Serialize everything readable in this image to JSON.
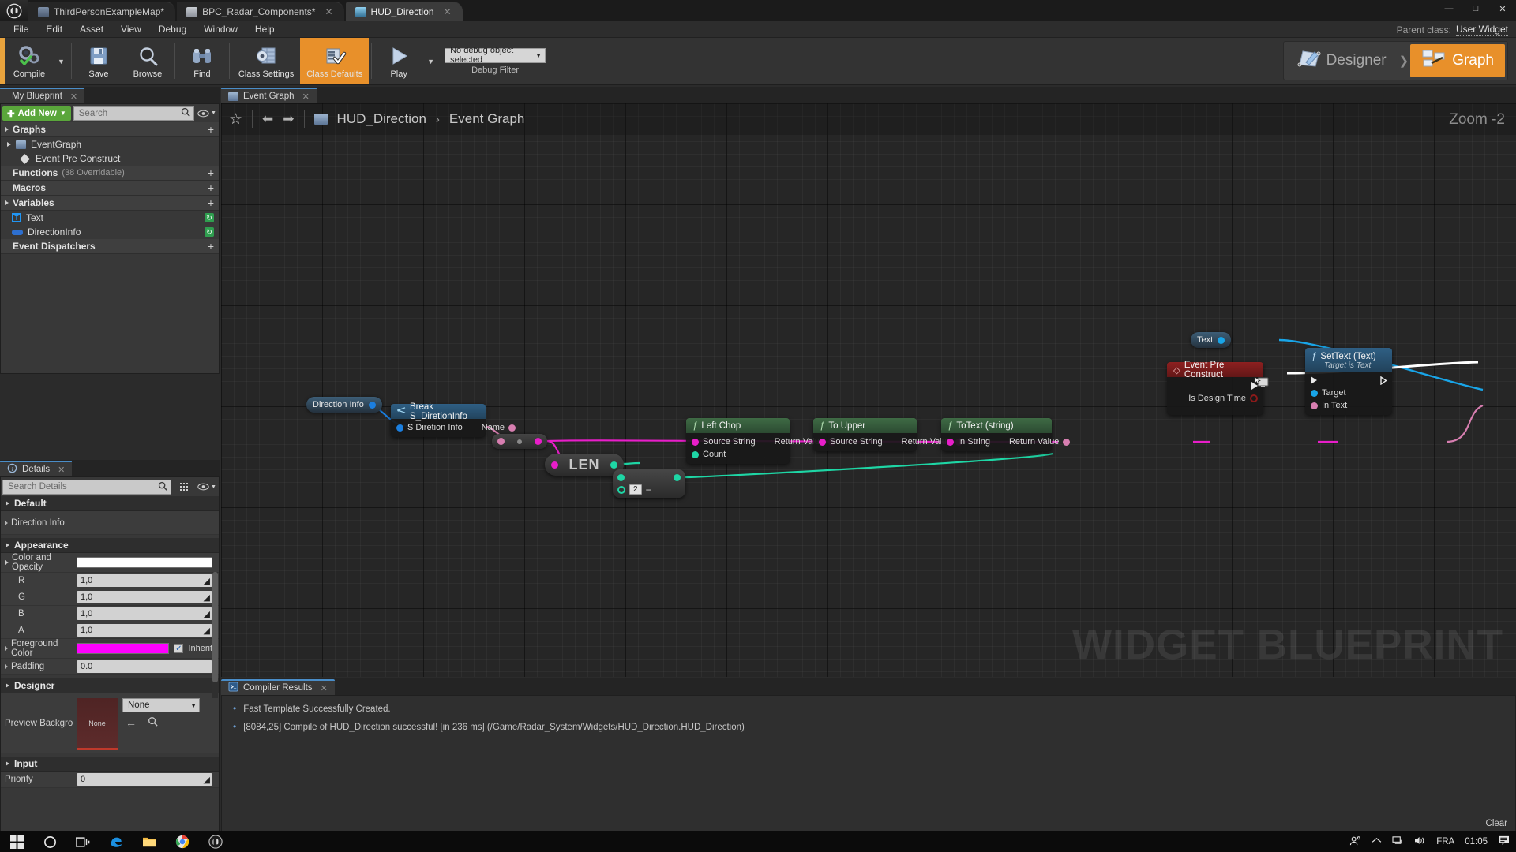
{
  "window": {
    "logo": "ue-logo",
    "tabs": [
      {
        "label": "ThirdPersonExampleMap*",
        "icon": "map-icon",
        "active": false,
        "closable": false
      },
      {
        "label": "BPC_Radar_Components*",
        "icon": "blueprint-icon",
        "active": false,
        "closable": true
      },
      {
        "label": "HUD_Direction",
        "icon": "widget-icon",
        "active": true,
        "closable": true
      }
    ],
    "controls": {
      "minimize": "—",
      "maximize": "□",
      "close": "✕"
    }
  },
  "menubar": {
    "items": [
      "File",
      "Edit",
      "Asset",
      "View",
      "Debug",
      "Window",
      "Help"
    ],
    "parent_class_label": "Parent class:",
    "parent_class_value": "User Widget"
  },
  "toolbar": {
    "compile": "Compile",
    "save": "Save",
    "browse": "Browse",
    "find": "Find",
    "class_settings": "Class Settings",
    "class_defaults": "Class Defaults",
    "play": "Play",
    "debug_value": "No debug object selected",
    "debug_filter_label": "Debug Filter",
    "accent_color": "#e8902a"
  },
  "mode_switch": {
    "designer": "Designer",
    "graph": "Graph",
    "active": "Graph"
  },
  "my_blueprint": {
    "tab_label": "My Blueprint",
    "add_new": "Add New",
    "search_placeholder": "Search",
    "sections": [
      {
        "title": "Graphs",
        "sub": "",
        "items": [
          {
            "label": "EventGraph",
            "icon": "graph-icon",
            "indent": false
          },
          {
            "label": "Event Pre Construct",
            "icon": "event-diamond-icon",
            "indent": true
          }
        ]
      },
      {
        "title": "Functions",
        "sub": "(38 Overridable)",
        "items": []
      },
      {
        "title": "Macros",
        "sub": "",
        "items": []
      },
      {
        "title": "Variables",
        "sub": "",
        "items": [
          {
            "label": "Text",
            "icon": "text-variable-icon",
            "indent": false
          },
          {
            "label": "DirectionInfo",
            "icon": "struct-variable-icon",
            "indent": false
          }
        ]
      },
      {
        "title": "Event Dispatchers",
        "sub": "",
        "items": []
      }
    ]
  },
  "details": {
    "tab_label": "Details",
    "search_placeholder": "Search Details",
    "sections": [
      {
        "title": "Default",
        "rows": [
          {
            "name": "Direction Info",
            "type": "empty",
            "expandable": true
          }
        ]
      },
      {
        "title": "Appearance",
        "rows": [
          {
            "name": "Color and Opacity",
            "type": "swatch",
            "value": "",
            "color": "#ffffff",
            "expandable": true,
            "expanded": true
          },
          {
            "name": "R",
            "type": "number",
            "value": "1,0",
            "indent": true
          },
          {
            "name": "G",
            "type": "number",
            "value": "1,0",
            "indent": true
          },
          {
            "name": "B",
            "type": "number",
            "value": "1,0",
            "indent": true
          },
          {
            "name": "A",
            "type": "number",
            "value": "1,0",
            "indent": true
          },
          {
            "name": "Foreground Color",
            "type": "swatch-inherit",
            "color": "#ff00ff",
            "checkbox_label": "Inherit",
            "checked": true,
            "expandable": true
          },
          {
            "name": "Padding",
            "type": "text",
            "value": "0.0",
            "expandable": true
          }
        ]
      },
      {
        "title": "Designer",
        "rows": [
          {
            "name": "Preview Backgroun",
            "type": "asset",
            "thumb_label": "None",
            "combo_value": "None"
          }
        ]
      },
      {
        "title": "Input",
        "rows": [
          {
            "name": "Priority",
            "type": "number",
            "value": "0"
          }
        ]
      }
    ]
  },
  "graph": {
    "tab_label": "Event Graph",
    "breadcrumb": {
      "root": "HUD_Direction",
      "sep": "›",
      "current": "Event Graph"
    },
    "zoom_label": "Zoom -2",
    "watermark": "WIDGET BLUEPRINT",
    "nodes": [
      {
        "id": "direction-info-var",
        "type": "variable-get",
        "title": "Direction Info",
        "out_pin": "struct"
      },
      {
        "id": "break-struct",
        "type": "function",
        "title": "Break S_DiretionInfo",
        "inputs": [
          {
            "label": "S Diretion Info",
            "pin": "struct"
          }
        ],
        "outputs": [
          {
            "label": "Name",
            "pin": "string"
          }
        ]
      },
      {
        "id": "reroute-knot",
        "type": "knot",
        "title": ""
      },
      {
        "id": "len-node",
        "type": "pure-op",
        "title": "LEN"
      },
      {
        "id": "subtract-node",
        "type": "pure-op",
        "title": "−",
        "literal": "2"
      },
      {
        "id": "left-chop",
        "type": "function",
        "title": "Left Chop",
        "inputs": [
          {
            "label": "Source String",
            "pin": "string"
          },
          {
            "label": "Count",
            "pin": "int"
          }
        ],
        "outputs": [
          {
            "label": "Return Value",
            "pin": "string"
          }
        ]
      },
      {
        "id": "to-upper",
        "type": "function",
        "title": "To Upper",
        "inputs": [
          {
            "label": "Source String",
            "pin": "string"
          }
        ],
        "outputs": [
          {
            "label": "Return Value",
            "pin": "string"
          }
        ]
      },
      {
        "id": "to-text",
        "type": "function",
        "title": "ToText (string)",
        "inputs": [
          {
            "label": "In String",
            "pin": "string"
          }
        ],
        "outputs": [
          {
            "label": "Return Value",
            "pin": "text"
          }
        ]
      },
      {
        "id": "text-var",
        "type": "variable-get",
        "title": "Text",
        "out_pin": "object"
      },
      {
        "id": "event-pre-construct",
        "type": "event",
        "title": "Event Pre Construct",
        "outputs": [
          {
            "label": "Is Design Time",
            "pin": "bool"
          }
        ]
      },
      {
        "id": "set-text",
        "type": "function",
        "title": "SetText (Text)",
        "subtitle": "Target is Text",
        "inputs": [
          {
            "label": "Target",
            "pin": "object"
          },
          {
            "label": "In Text",
            "pin": "text"
          }
        ],
        "outputs": []
      }
    ]
  },
  "compiler": {
    "tab_label": "Compiler Results",
    "clear_label": "Clear",
    "messages": [
      "Fast Template Successfully Created.",
      "[8084,25] Compile of HUD_Direction successful! [in 236 ms] (/Game/Radar_System/Widgets/HUD_Direction.HUD_Direction)"
    ]
  },
  "taskbar": {
    "items": [
      "start-icon",
      "cortana-icon",
      "task-view-icon",
      "edge-icon",
      "file-explorer-icon",
      "chrome-icon",
      "unreal-icon"
    ],
    "tray": {
      "people_icon": "people-icon",
      "chevron_icon": "show-hidden-icons",
      "network_icon": "network-icon",
      "volume_icon": "volume-icon",
      "language": "FRA",
      "time": "01:05",
      "notifications_icon": "action-center-icon"
    }
  }
}
